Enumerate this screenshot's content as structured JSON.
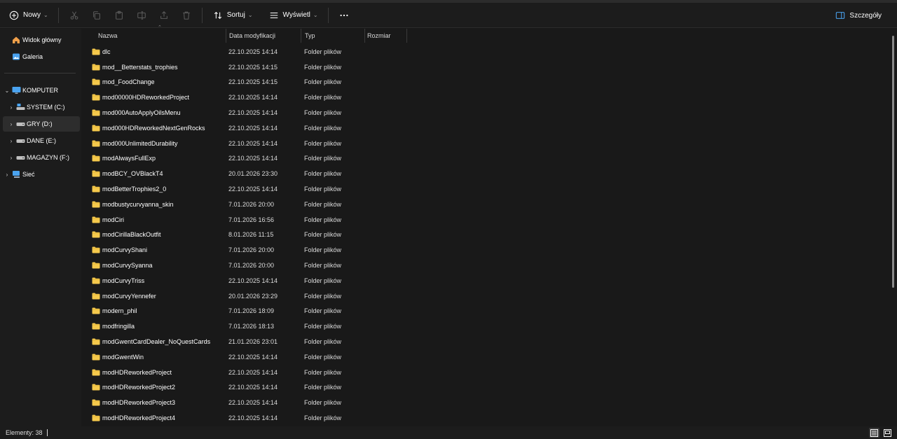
{
  "toolbar": {
    "new_label": "Nowy",
    "sort_label": "Sortuj",
    "view_label": "Wyświetl",
    "details_label": "Szczegóły"
  },
  "sidebar": {
    "quick": [
      {
        "label": "Widok główny",
        "icon": "home-icon"
      },
      {
        "label": "Galeria",
        "icon": "gallery-icon"
      }
    ],
    "computer": {
      "label": "KOMPUTER",
      "icon": "monitor-icon"
    },
    "drives": [
      {
        "label": "SYSTEM (C:)",
        "icon": "system-drive-icon",
        "selected": false
      },
      {
        "label": "GRY (D:)",
        "icon": "drive-icon",
        "selected": true
      },
      {
        "label": "DANE (E:)",
        "icon": "drive-icon",
        "selected": false
      },
      {
        "label": "MAGAZYN (F:)",
        "icon": "drive-icon",
        "selected": false
      }
    ],
    "network": {
      "label": "Sieć",
      "icon": "network-icon"
    }
  },
  "columns": {
    "name": "Nazwa",
    "date": "Data modyfikacji",
    "type": "Typ",
    "size": "Rozmiar"
  },
  "files": [
    {
      "name": "dlc",
      "date": "22.10.2025 14:14",
      "type": "Folder plików"
    },
    {
      "name": "mod__Betterstats_trophies",
      "date": "22.10.2025 14:15",
      "type": "Folder plików"
    },
    {
      "name": "mod_FoodChange",
      "date": "22.10.2025 14:15",
      "type": "Folder plików"
    },
    {
      "name": "mod00000HDReworkedProject",
      "date": "22.10.2025 14:14",
      "type": "Folder plików"
    },
    {
      "name": "mod000AutoApplyOilsMenu",
      "date": "22.10.2025 14:14",
      "type": "Folder plików"
    },
    {
      "name": "mod000HDReworkedNextGenRocks",
      "date": "22.10.2025 14:14",
      "type": "Folder plików"
    },
    {
      "name": "mod000UnlimitedDurability",
      "date": "22.10.2025 14:14",
      "type": "Folder plików"
    },
    {
      "name": "modAlwaysFullExp",
      "date": "22.10.2025 14:14",
      "type": "Folder plików"
    },
    {
      "name": "modBCY_OVBlackT4",
      "date": "20.01.2026 23:30",
      "type": "Folder plików"
    },
    {
      "name": "modBetterTrophies2_0",
      "date": "22.10.2025 14:14",
      "type": "Folder plików"
    },
    {
      "name": "modbustycurvyanna_skin",
      "date": "7.01.2026 20:00",
      "type": "Folder plików"
    },
    {
      "name": "modCiri",
      "date": "7.01.2026 16:56",
      "type": "Folder plików"
    },
    {
      "name": "modCirillaBlackOutfit",
      "date": "8.01.2026 11:15",
      "type": "Folder plików"
    },
    {
      "name": "modCurvyShani",
      "date": "7.01.2026 20:00",
      "type": "Folder plików"
    },
    {
      "name": "modCurvySyanna",
      "date": "7.01.2026 20:00",
      "type": "Folder plików"
    },
    {
      "name": "modCurvyTriss",
      "date": "22.10.2025 14:14",
      "type": "Folder plików"
    },
    {
      "name": "modCurvyYennefer",
      "date": "20.01.2026 23:29",
      "type": "Folder plików"
    },
    {
      "name": "modern_phil",
      "date": "7.01.2026 18:09",
      "type": "Folder plików"
    },
    {
      "name": "modfringilla",
      "date": "7.01.2026 18:13",
      "type": "Folder plików"
    },
    {
      "name": "modGwentCardDealer_NoQuestCards",
      "date": "21.01.2026 23:01",
      "type": "Folder plików"
    },
    {
      "name": "modGwentWin",
      "date": "22.10.2025 14:14",
      "type": "Folder plików"
    },
    {
      "name": "modHDReworkedProject",
      "date": "22.10.2025 14:14",
      "type": "Folder plików"
    },
    {
      "name": "modHDReworkedProject2",
      "date": "22.10.2025 14:14",
      "type": "Folder plików"
    },
    {
      "name": "modHDReworkedProject3",
      "date": "22.10.2025 14:14",
      "type": "Folder plików"
    },
    {
      "name": "modHDReworkedProject4",
      "date": "22.10.2025 14:14",
      "type": "Folder plików"
    }
  ],
  "status": {
    "items_text": "Elementy: 38"
  },
  "colors": {
    "background": "#191919",
    "folder": "#f5c94c",
    "drive_accent": "#4aa3f0",
    "selected_bg": "#2d2d2d"
  }
}
